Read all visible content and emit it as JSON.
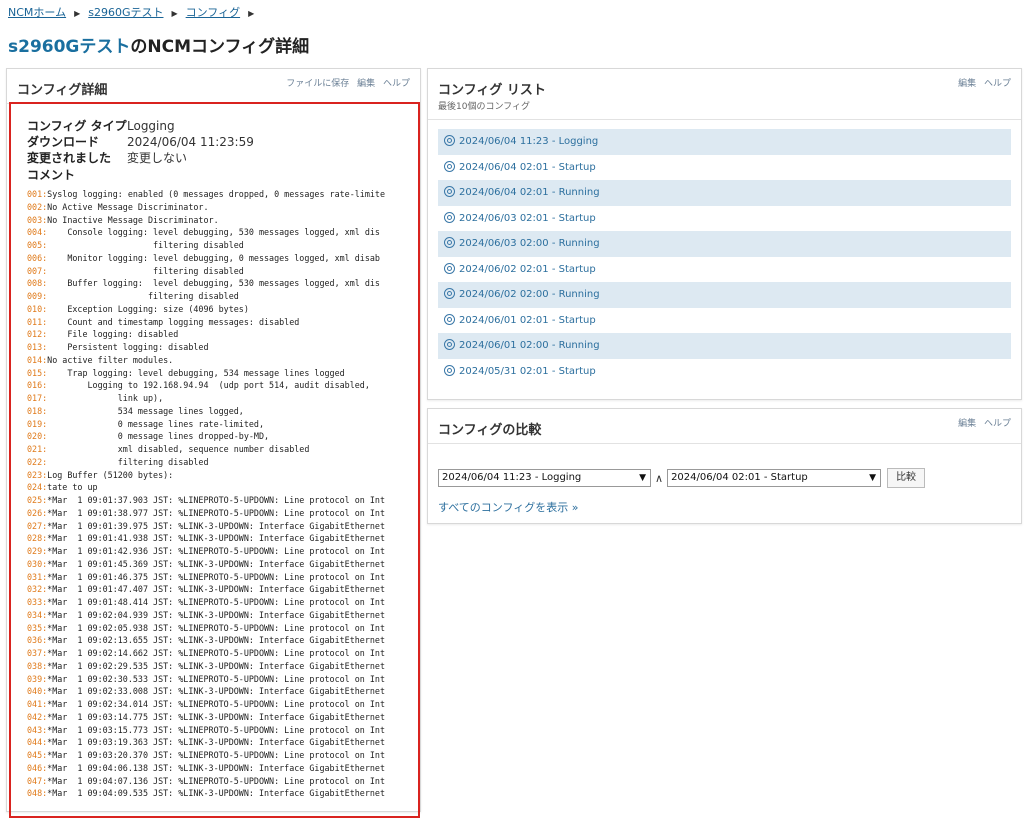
{
  "breadcrumb": [
    "NCMホーム",
    "s2960Gテスト",
    "コンフィグ"
  ],
  "title": {
    "device": "s2960Gテスト",
    "rest": "のNCMコンフィグ詳細"
  },
  "detail": {
    "title": "コンフィグ詳細",
    "actions": [
      "ファイルに保存",
      "編集",
      "ヘルプ"
    ],
    "meta": [
      {
        "label": "コンフィグ タイプ",
        "value": "Logging"
      },
      {
        "label": "ダウンロード",
        "value": "2024/06/04 11:23:59"
      },
      {
        "label": "変更されました",
        "value": "変更しない"
      }
    ],
    "comment_label": "コメント",
    "lines": [
      {
        "n": "001:",
        "t": "Syslog logging: enabled (0 messages dropped, 0 messages rate-limite"
      },
      {
        "n": "002:",
        "t": "No Active Message Discriminator."
      },
      {
        "n": "003:",
        "t": "No Inactive Message Discriminator."
      },
      {
        "n": "004:",
        "t": "    Console logging: level debugging, 530 messages logged, xml dis"
      },
      {
        "n": "005:",
        "t": "                     filtering disabled"
      },
      {
        "n": "006:",
        "t": "    Monitor logging: level debugging, 0 messages logged, xml disab"
      },
      {
        "n": "007:",
        "t": "                     filtering disabled"
      },
      {
        "n": "008:",
        "t": "    Buffer logging:  level debugging, 530 messages logged, xml dis"
      },
      {
        "n": "009:",
        "t": "                    filtering disabled"
      },
      {
        "n": "010:",
        "t": "    Exception Logging: size (4096 bytes)"
      },
      {
        "n": "011:",
        "t": "    Count and timestamp logging messages: disabled"
      },
      {
        "n": "012:",
        "t": "    File logging: disabled"
      },
      {
        "n": "013:",
        "t": "    Persistent logging: disabled"
      },
      {
        "n": "014:",
        "t": "No active filter modules."
      },
      {
        "n": "015:",
        "t": "    Trap logging: level debugging, 534 message lines logged"
      },
      {
        "n": "016:",
        "t": "        Logging to 192.168.94.94  (udp port 514, audit disabled,"
      },
      {
        "n": "017:",
        "t": "              link up),"
      },
      {
        "n": "018:",
        "t": "              534 message lines logged,"
      },
      {
        "n": "019:",
        "t": "              0 message lines rate-limited,"
      },
      {
        "n": "020:",
        "t": "              0 message lines dropped-by-MD,"
      },
      {
        "n": "021:",
        "t": "              xml disabled, sequence number disabled"
      },
      {
        "n": "022:",
        "t": "              filtering disabled"
      },
      {
        "n": "023:",
        "t": "Log Buffer (51200 bytes):"
      },
      {
        "n": "024:",
        "t": "tate to up"
      },
      {
        "n": "025:",
        "t": "*Mar  1 09:01:37.903 JST: %LINEPROTO-5-UPDOWN: Line protocol on Int"
      },
      {
        "n": "026:",
        "t": "*Mar  1 09:01:38.977 JST: %LINEPROTO-5-UPDOWN: Line protocol on Int"
      },
      {
        "n": "027:",
        "t": "*Mar  1 09:01:39.975 JST: %LINK-3-UPDOWN: Interface GigabitEthernet"
      },
      {
        "n": "028:",
        "t": "*Mar  1 09:01:41.938 JST: %LINK-3-UPDOWN: Interface GigabitEthernet"
      },
      {
        "n": "029:",
        "t": "*Mar  1 09:01:42.936 JST: %LINEPROTO-5-UPDOWN: Line protocol on Int"
      },
      {
        "n": "030:",
        "t": "*Mar  1 09:01:45.369 JST: %LINK-3-UPDOWN: Interface GigabitEthernet"
      },
      {
        "n": "031:",
        "t": "*Mar  1 09:01:46.375 JST: %LINEPROTO-5-UPDOWN: Line protocol on Int"
      },
      {
        "n": "032:",
        "t": "*Mar  1 09:01:47.407 JST: %LINK-3-UPDOWN: Interface GigabitEthernet"
      },
      {
        "n": "033:",
        "t": "*Mar  1 09:01:48.414 JST: %LINEPROTO-5-UPDOWN: Line protocol on Int"
      },
      {
        "n": "034:",
        "t": "*Mar  1 09:02:04.939 JST: %LINK-3-UPDOWN: Interface GigabitEthernet"
      },
      {
        "n": "035:",
        "t": "*Mar  1 09:02:05.938 JST: %LINEPROTO-5-UPDOWN: Line protocol on Int"
      },
      {
        "n": "036:",
        "t": "*Mar  1 09:02:13.655 JST: %LINK-3-UPDOWN: Interface GigabitEthernet"
      },
      {
        "n": "037:",
        "t": "*Mar  1 09:02:14.662 JST: %LINEPROTO-5-UPDOWN: Line protocol on Int"
      },
      {
        "n": "038:",
        "t": "*Mar  1 09:02:29.535 JST: %LINK-3-UPDOWN: Interface GigabitEthernet"
      },
      {
        "n": "039:",
        "t": "*Mar  1 09:02:30.533 JST: %LINEPROTO-5-UPDOWN: Line protocol on Int"
      },
      {
        "n": "040:",
        "t": "*Mar  1 09:02:33.008 JST: %LINK-3-UPDOWN: Interface GigabitEthernet"
      },
      {
        "n": "041:",
        "t": "*Mar  1 09:02:34.014 JST: %LINEPROTO-5-UPDOWN: Line protocol on Int"
      },
      {
        "n": "042:",
        "t": "*Mar  1 09:03:14.775 JST: %LINK-3-UPDOWN: Interface GigabitEthernet"
      },
      {
        "n": "043:",
        "t": "*Mar  1 09:03:15.773 JST: %LINEPROTO-5-UPDOWN: Line protocol on Int"
      },
      {
        "n": "044:",
        "t": "*Mar  1 09:03:19.363 JST: %LINK-3-UPDOWN: Interface GigabitEthernet"
      },
      {
        "n": "045:",
        "t": "*Mar  1 09:03:20.370 JST: %LINEPROTO-5-UPDOWN: Line protocol on Int"
      },
      {
        "n": "046:",
        "t": "*Mar  1 09:04:06.138 JST: %LINK-3-UPDOWN: Interface GigabitEthernet"
      },
      {
        "n": "047:",
        "t": "*Mar  1 09:04:07.136 JST: %LINEPROTO-5-UPDOWN: Line protocol on Int"
      },
      {
        "n": "048:",
        "t": "*Mar  1 09:04:09.535 JST: %LINK-3-UPDOWN: Interface GigabitEthernet"
      }
    ]
  },
  "config_list": {
    "title": "コンフィグ リスト",
    "subtitle": "最後10個のコンフィグ",
    "actions": [
      "編集",
      "ヘルプ"
    ],
    "items": [
      "2024/06/04 11:23 - Logging",
      "2024/06/04 02:01 - Startup",
      "2024/06/04 02:01 - Running",
      "2024/06/03 02:01 - Startup",
      "2024/06/03 02:00 - Running",
      "2024/06/02 02:01 - Startup",
      "2024/06/02 02:00 - Running",
      "2024/06/01 02:01 - Startup",
      "2024/06/01 02:00 - Running",
      "2024/05/31 02:01 - Startup"
    ]
  },
  "compare": {
    "title": "コンフィグの比較",
    "actions": [
      "編集",
      "ヘルプ"
    ],
    "select1": "2024/06/04 11:23 - Logging",
    "select2": "2024/06/04 02:01 - Startup",
    "wedge": "∧",
    "button": "比較",
    "all_link": "すべてのコンフィグを表示 »"
  },
  "colors": {
    "link": "#1a6496",
    "highlight_border": "#d9231f",
    "row_alt": "#dde9f2",
    "line_number": "#e07a1a"
  }
}
